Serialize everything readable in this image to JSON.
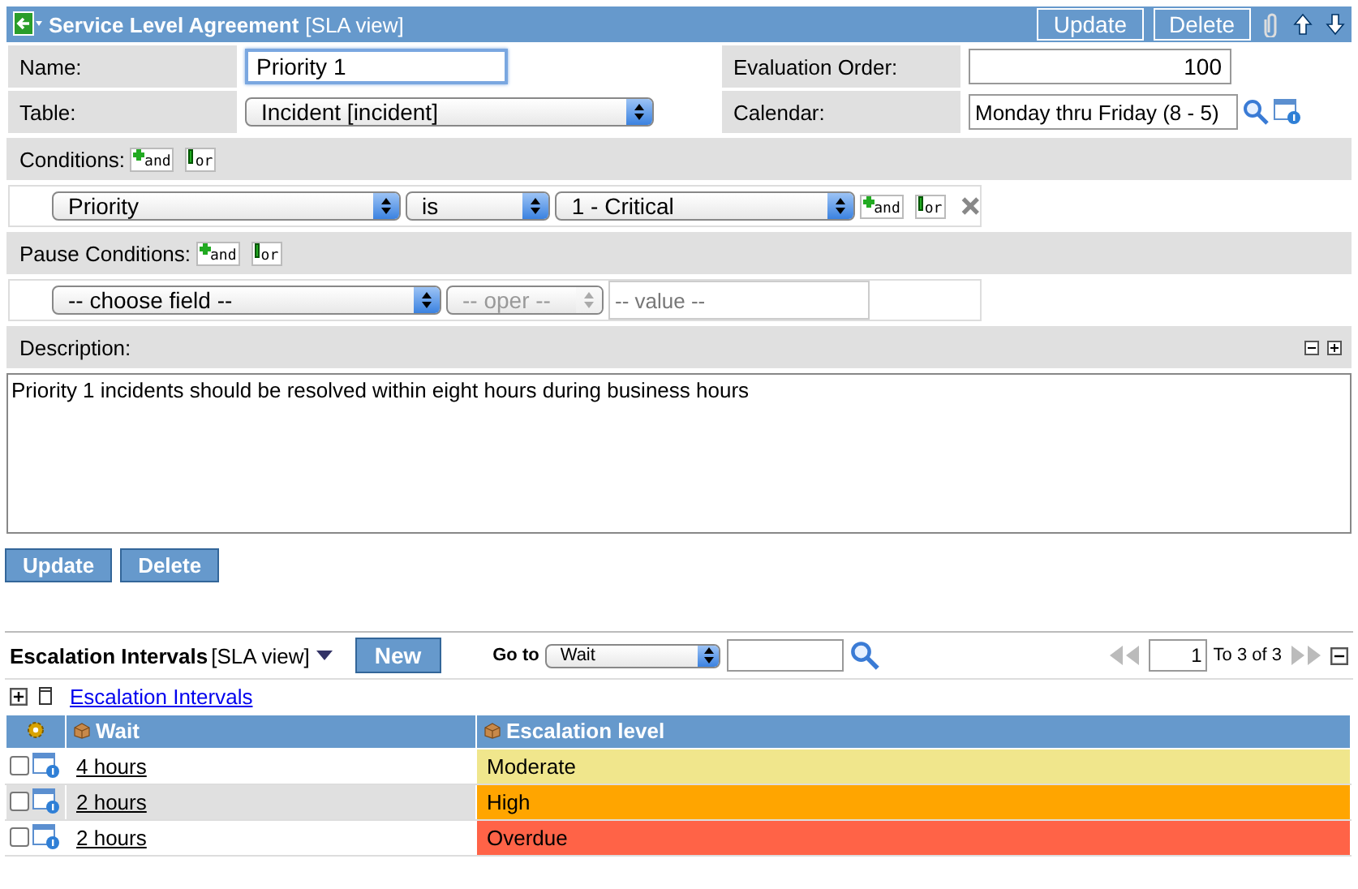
{
  "header": {
    "title": "Service Level Agreement",
    "view": "[SLA view]",
    "buttons": [
      "Update",
      "Delete"
    ]
  },
  "form": {
    "left": [
      {
        "label": "Name:",
        "kind": "input",
        "value": "Priority 1",
        "focused": true
      },
      {
        "label": "Table:",
        "kind": "select",
        "value": "Incident [incident]",
        "focused": false
      }
    ],
    "right": [
      {
        "label": "Evaluation Order:",
        "kind": "number",
        "value": "100"
      },
      {
        "label": "Calendar:",
        "kind": "lookup",
        "value": "Monday thru Friday (8 - 5)"
      }
    ]
  },
  "conditions": {
    "label": "Conditions:",
    "add": [
      {
        "kind": "and",
        "label": "and"
      },
      {
        "kind": "or",
        "label": "or"
      }
    ],
    "rows": [
      {
        "field": "Priority",
        "operator": "is",
        "operator_disabled": false,
        "value": "1 - Critical",
        "kind": "select",
        "removable": true
      }
    ]
  },
  "pause_conditions": {
    "label": "Pause Conditions:",
    "add": [
      {
        "kind": "and",
        "label": "and"
      },
      {
        "kind": "or",
        "label": "or"
      }
    ],
    "rows": [
      {
        "field": "-- choose field --",
        "operator": "-- oper --",
        "operator_disabled": true,
        "placeholder": "-- value --",
        "kind": "input",
        "removable": false
      }
    ]
  },
  "description": {
    "label": "Description:",
    "text": "Priority 1 incidents should be resolved within eight hours during business hours"
  },
  "buttons": [
    "Update",
    "Delete"
  ],
  "escalation": {
    "title": "Escalation Intervals",
    "view": "[SLA view]",
    "new_button": "New",
    "goto_label": "Go to",
    "goto_field": "Wait",
    "page": "1",
    "range": "To 3 of 3",
    "link": "Escalation Intervals",
    "columns": [
      "Wait",
      "Escalation level"
    ],
    "rows": [
      {
        "checked": false,
        "wait": "4 hours",
        "level": "Moderate",
        "color": "#f0e68c"
      },
      {
        "checked": false,
        "wait": "2 hours",
        "level": "High",
        "color": "#ffa500"
      },
      {
        "checked": false,
        "wait": "2 hours",
        "level": "Overdue",
        "color": "#ff6347"
      }
    ]
  }
}
